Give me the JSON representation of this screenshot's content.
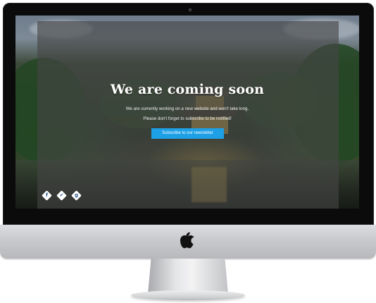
{
  "page": {
    "headline": "We are coming soon",
    "message_line1": "We are currently working on a new website and won't take long.",
    "message_line2": "Please don't forget to subscribe to be notified!",
    "subscribe_button": "Subscribe to our newsletter"
  },
  "social_links": [
    {
      "icon": "facebook-icon",
      "glyph": "f"
    },
    {
      "icon": "twitter-icon",
      "glyph": "✔"
    },
    {
      "icon": "google-plus-icon",
      "glyph": "g"
    }
  ],
  "colors": {
    "accent": "#1ea0e6",
    "overlay": "rgba(70,70,70,0.62)",
    "bezel": "#0b0b0b"
  }
}
